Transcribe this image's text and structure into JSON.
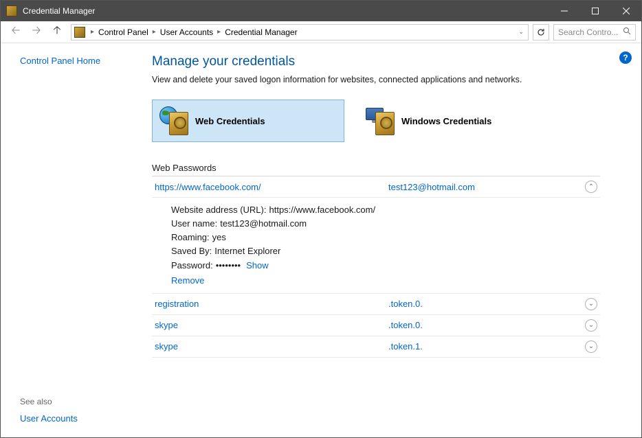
{
  "window": {
    "title": "Credential Manager"
  },
  "breadcrumb": {
    "items": [
      "Control Panel",
      "User Accounts",
      "Credential Manager"
    ]
  },
  "search": {
    "placeholder": "Search Contro..."
  },
  "left": {
    "home": "Control Panel Home",
    "see_also": "See also",
    "user_accounts": "User Accounts"
  },
  "main": {
    "heading": "Manage your credentials",
    "subtext": "View and delete your saved logon information for websites, connected applications and networks.",
    "tile_web": "Web Credentials",
    "tile_windows": "Windows Credentials",
    "section": "Web Passwords"
  },
  "expanded": {
    "site": "https://www.facebook.com/",
    "ident": "test123@hotmail.com",
    "url_label": "Website address (URL):",
    "url_value": "https://www.facebook.com/",
    "user_label": "User name:",
    "user_value": "test123@hotmail.com",
    "roaming_label": "Roaming:",
    "roaming_value": "yes",
    "savedby_label": "Saved By:",
    "savedby_value": "Internet Explorer",
    "password_label": "Password:",
    "password_value": "••••••••",
    "show": "Show",
    "remove": "Remove"
  },
  "rows": [
    {
      "site": "registration",
      "ident": ".token.0."
    },
    {
      "site": "skype",
      "ident": ".token.0."
    },
    {
      "site": "skype",
      "ident": ".token.1."
    }
  ]
}
